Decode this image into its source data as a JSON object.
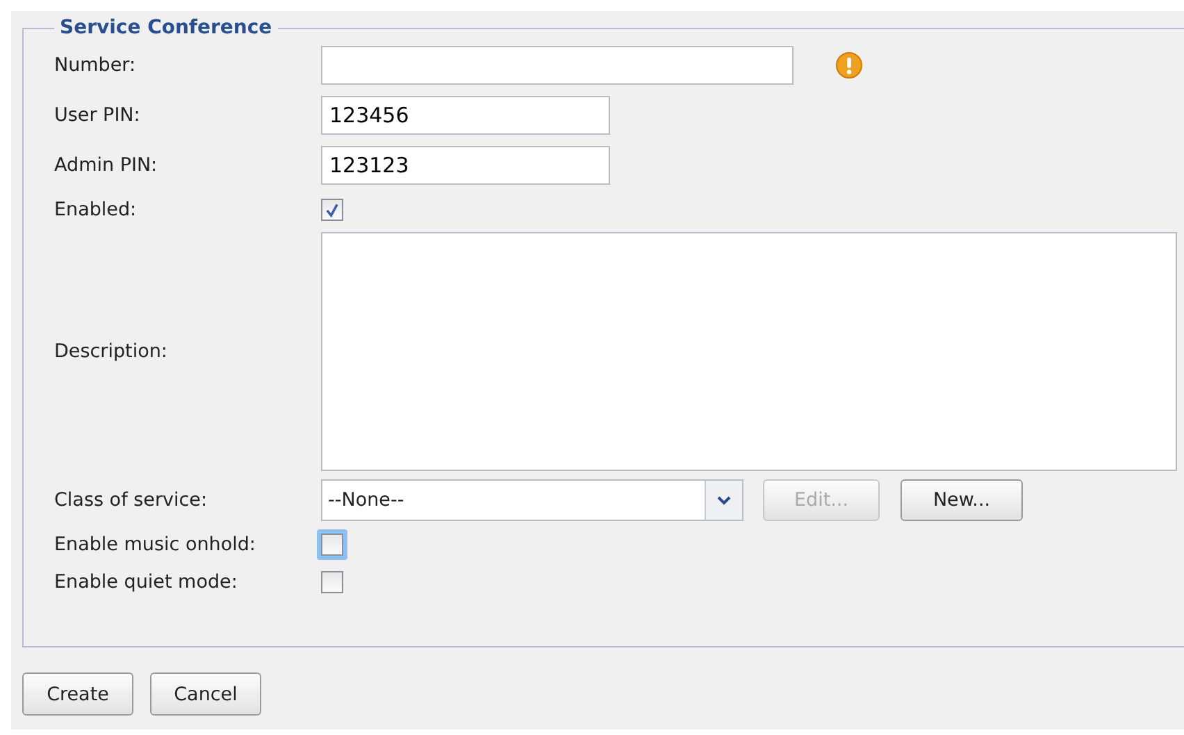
{
  "fieldset": {
    "legend": "Service Conference",
    "rows": [
      {
        "kind": "text",
        "label": "Number:",
        "value": "",
        "wide": true,
        "warning": true
      },
      {
        "kind": "text",
        "label": "User PIN:",
        "value": "123456",
        "wide": false,
        "warning": false
      },
      {
        "kind": "text",
        "label": "Admin PIN:",
        "value": "123123",
        "wide": false,
        "warning": false
      },
      {
        "kind": "checkbox",
        "label": "Enabled:",
        "checked": true,
        "focused": false
      },
      {
        "kind": "textarea",
        "label": "Description:",
        "value": ""
      },
      {
        "kind": "select",
        "label": "Class of service:",
        "value": "--None--",
        "buttons": [
          {
            "label": "Edit...",
            "disabled": true
          },
          {
            "label": "New...",
            "disabled": false
          }
        ]
      },
      {
        "kind": "checkbox",
        "label": "Enable music onhold:",
        "checked": false,
        "focused": true
      },
      {
        "kind": "checkbox",
        "label": "Enable quiet mode:",
        "checked": false,
        "focused": false
      }
    ]
  },
  "buttons": [
    {
      "label": "Create"
    },
    {
      "label": "Cancel"
    }
  ]
}
